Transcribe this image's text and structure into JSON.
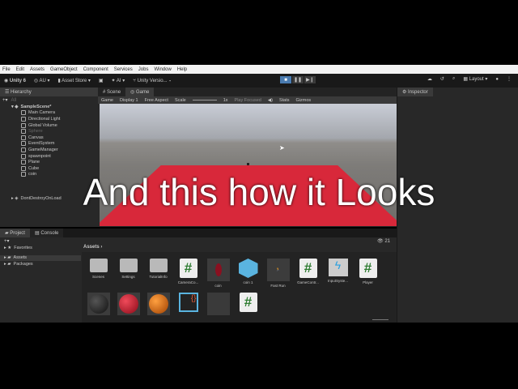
{
  "menu": [
    "File",
    "Edit",
    "Assets",
    "GameObject",
    "Component",
    "Services",
    "Jobs",
    "Window",
    "Help"
  ],
  "toolbar": {
    "account": "Unity 6",
    "au": "AU",
    "asset_store": "Asset Store",
    "ai": "AI",
    "version": "Unity Versio...",
    "layout": "Layout"
  },
  "hierarchy": {
    "tab": "Hierarchy",
    "search_placeholder": "All",
    "scene": "SampleScene*",
    "items": [
      "Main Camera",
      "Directional Light",
      "Global Volume",
      "Sphere",
      "Canvas",
      "EventSystem",
      "GameManager",
      "spawnpoint",
      "Plane",
      "Cube",
      "coin"
    ],
    "dont_destroy": "DontDestroyOnLoad"
  },
  "center": {
    "tabs": [
      "Scene",
      "Game"
    ],
    "game_bar": {
      "mode": "Game",
      "display": "Display 1",
      "aspect": "Free Aspect",
      "scale_label": "Scale",
      "scale": "1x",
      "play_focused": "Play Focused",
      "stats": "Stats",
      "gizmos": "Gizmos"
    }
  },
  "inspector": {
    "tab": "Inspector"
  },
  "project": {
    "tabs": [
      "Project",
      "Console"
    ],
    "favorites": "Favorites",
    "assets": "Assets",
    "packages": "Packages",
    "breadcrumb": "Assets",
    "count": "21",
    "row1": [
      {
        "name": "Scenes",
        "type": "folder"
      },
      {
        "name": "Settings",
        "type": "folder"
      },
      {
        "name": "TutorialInfo",
        "type": "folder"
      },
      {
        "name": "CameraCo...",
        "type": "script"
      },
      {
        "name": "coin",
        "type": "model"
      },
      {
        "name": "coin 1",
        "type": "prefab"
      },
      {
        "name": "Fast Run",
        "type": "anim"
      },
      {
        "name": "GameContr...",
        "type": "script"
      },
      {
        "name": "InputSyste...",
        "type": "input"
      },
      {
        "name": "Player",
        "type": "script"
      }
    ],
    "row2_colors": [
      "#2a2a2a",
      "#c4182e",
      "#d86a0a"
    ]
  },
  "caption": "And this how it Looks",
  "colors": {
    "plane": "#d8283a",
    "accent": "#4a7bb0"
  }
}
